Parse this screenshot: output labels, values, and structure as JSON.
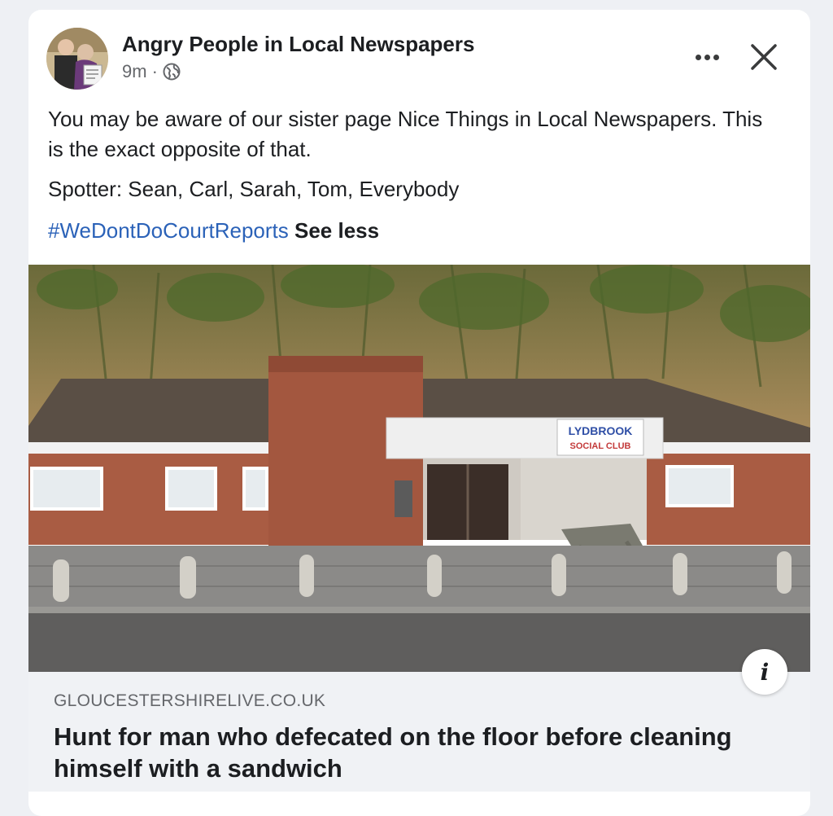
{
  "post": {
    "page_name": "Angry People in Local Newspapers",
    "time": "9m",
    "separator": "·",
    "visibility_icon": "globe-icon",
    "line1": "You may be aware of our sister page Nice Things in Local Newspapers. This is the exact opposite of that.",
    "line2": "Spotter: Sean, Carl, Sarah, Tom, Everybody",
    "hashtag": "#WeDontDoCourtReports",
    "see_less": "See less"
  },
  "photo": {
    "sign_line1": "LYDBROOK",
    "sign_line2": "SOCIAL CLUB"
  },
  "link_preview": {
    "domain": "GLOUCESTERSHIRELIVE.CO.UK",
    "headline": "Hunt for man who defecated on the floor before cleaning himself with a sandwich",
    "info_icon_label": "i"
  },
  "colors": {
    "hashtag": "#2b62b8",
    "secondary_text": "#65676b",
    "card_bg": "#ffffff",
    "link_bg": "#f0f2f5"
  }
}
